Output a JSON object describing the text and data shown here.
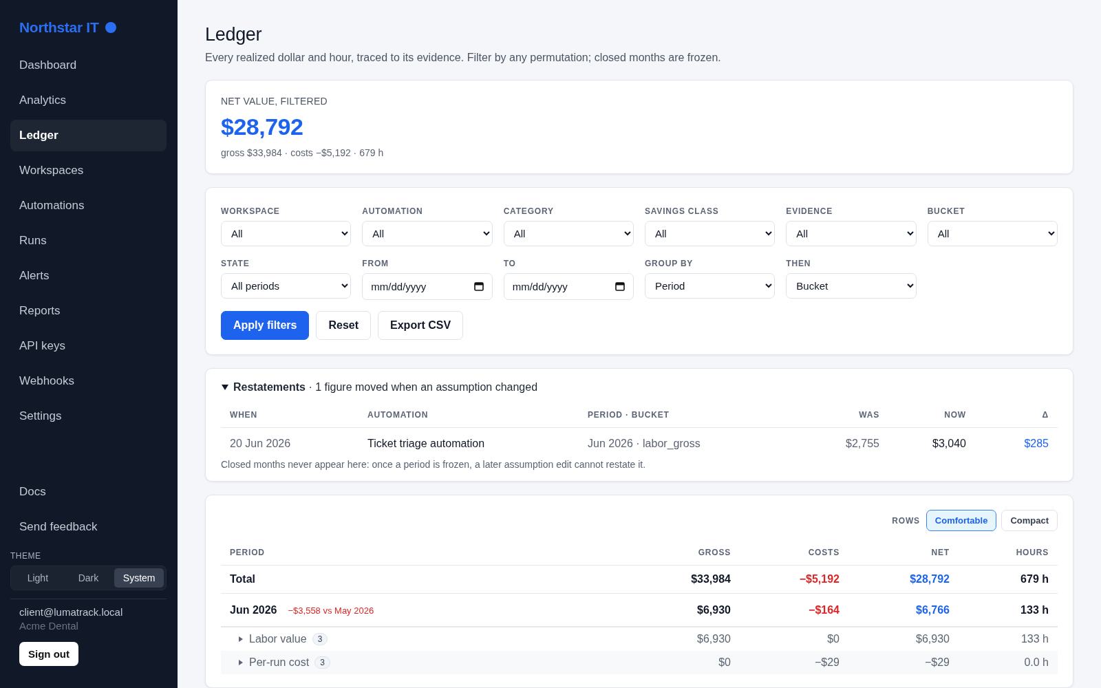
{
  "brand": {
    "name": "Northstar IT"
  },
  "nav": [
    {
      "label": "Dashboard",
      "selected": false
    },
    {
      "label": "Analytics",
      "selected": false
    },
    {
      "label": "Ledger",
      "selected": true
    },
    {
      "label": "Workspaces",
      "selected": false
    },
    {
      "label": "Automations",
      "selected": false
    },
    {
      "label": "Runs",
      "selected": false
    },
    {
      "label": "Alerts",
      "selected": false
    },
    {
      "label": "Reports",
      "selected": false
    },
    {
      "label": "API keys",
      "selected": false
    },
    {
      "label": "Webhooks",
      "selected": false
    },
    {
      "label": "Settings",
      "selected": false
    }
  ],
  "footer_nav": [
    {
      "label": "Docs"
    },
    {
      "label": "Send feedback"
    }
  ],
  "theme": {
    "label": "THEME",
    "options": [
      {
        "label": "Light",
        "selected": false
      },
      {
        "label": "Dark",
        "selected": false
      },
      {
        "label": "System",
        "selected": true
      }
    ]
  },
  "account": {
    "email": "client@lumatrack.local",
    "org": "Acme Dental",
    "sign_out": "Sign out"
  },
  "page": {
    "title": "Ledger",
    "subtitle": "Every realized dollar and hour, traced to its evidence. Filter by any permutation; closed months are frozen."
  },
  "summary": {
    "label": "NET VALUE, FILTERED",
    "value": "$28,792",
    "detail": "gross $33,984 · costs −$5,192 · 679 h"
  },
  "filters": {
    "fields": [
      {
        "label": "WORKSPACE",
        "kind": "select",
        "value": "All"
      },
      {
        "label": "AUTOMATION",
        "kind": "select",
        "value": "All"
      },
      {
        "label": "CATEGORY",
        "kind": "select",
        "value": "All"
      },
      {
        "label": "SAVINGS CLASS",
        "kind": "select",
        "value": "All"
      },
      {
        "label": "EVIDENCE",
        "kind": "select",
        "value": "All"
      },
      {
        "label": "BUCKET",
        "kind": "select",
        "value": "All"
      },
      {
        "label": "STATE",
        "kind": "select",
        "value": "All periods"
      },
      {
        "label": "FROM",
        "kind": "date",
        "placeholder": "mm/dd/yyyy"
      },
      {
        "label": "TO",
        "kind": "date",
        "placeholder": "mm/dd/yyyy"
      },
      {
        "label": "GROUP BY",
        "kind": "select",
        "value": "Period"
      },
      {
        "label": "THEN",
        "kind": "select",
        "value": "Bucket"
      }
    ],
    "buttons": [
      {
        "label": "Apply filters",
        "kind": "primary"
      },
      {
        "label": "Reset",
        "kind": "secondary"
      },
      {
        "label": "Export CSV",
        "kind": "secondary"
      }
    ]
  },
  "restatements": {
    "expanded": true,
    "title": "Restatements",
    "summary": " · 1 figure moved when an assumption changed",
    "columns": [
      "WHEN",
      "AUTOMATION",
      "PERIOD · BUCKET",
      "WAS",
      "NOW",
      "Δ"
    ],
    "rows": [
      {
        "when": "20 Jun 2026",
        "automation": "Ticket triage automation",
        "period_bucket": "Jun 2026 · labor_gross",
        "was": "$2,755",
        "now": "$3,040",
        "delta": "$285"
      }
    ],
    "note": "Closed months never appear here: once a period is frozen, a later assumption edit cannot restate it."
  },
  "ledger": {
    "density": {
      "label": "ROWS",
      "options": [
        {
          "label": "Comfortable",
          "selected": true
        },
        {
          "label": "Compact",
          "selected": false
        }
      ]
    },
    "columns": [
      "PERIOD",
      "GROSS",
      "COSTS",
      "NET",
      "HOURS"
    ],
    "rows": [
      {
        "kind": "total",
        "period": "Total",
        "gross": "$33,984",
        "costs": "−$5,192",
        "net": "$28,792",
        "hours": "679 h"
      },
      {
        "kind": "period",
        "period": "Jun 2026",
        "comparison": "−$3,558 vs May 2026",
        "gross": "$6,930",
        "costs": "−$164",
        "net": "$6,766",
        "hours": "133 h"
      },
      {
        "kind": "bucket",
        "period": "Labor value",
        "count": "3",
        "expanded": false,
        "gross": "$6,930",
        "costs": "$0",
        "net": "$6,930",
        "hours": "133 h"
      },
      {
        "kind": "bucket",
        "period": "Per-run cost",
        "count": "3",
        "expanded": false,
        "gross": "$0",
        "costs": "−$29",
        "net": "−$29",
        "hours": "0.0 h"
      }
    ]
  }
}
